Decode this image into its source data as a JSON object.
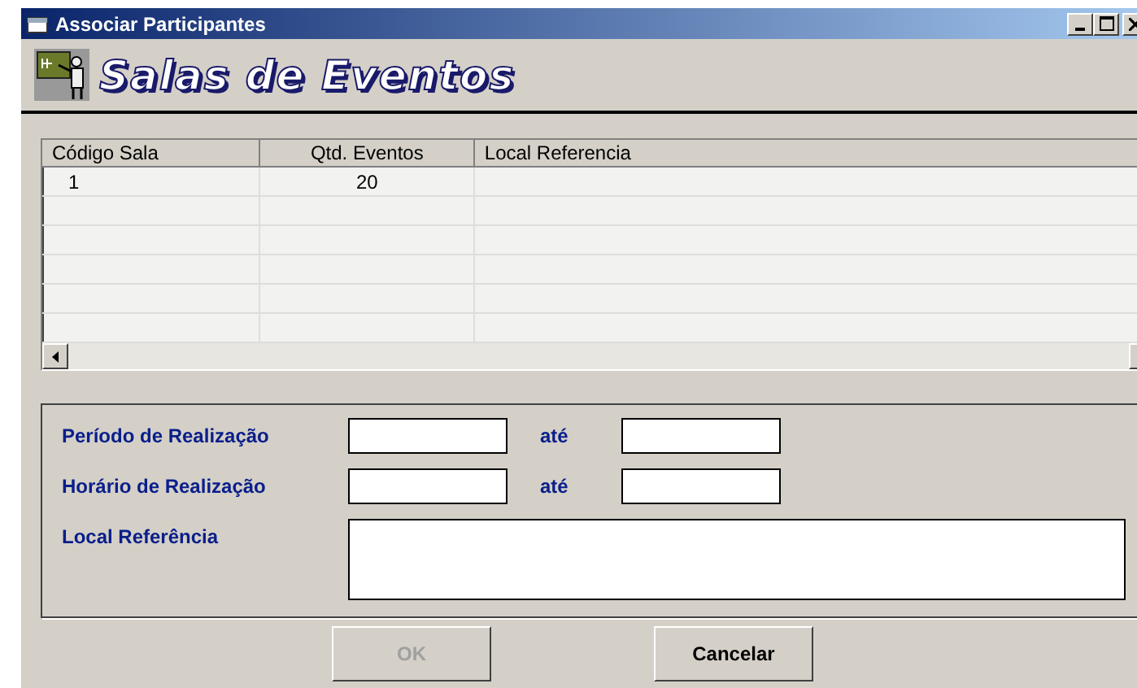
{
  "window": {
    "title": "Associar Participantes"
  },
  "header": {
    "title": "Salas de Eventos"
  },
  "table": {
    "columns": [
      {
        "label": "Código Sala"
      },
      {
        "label": "Qtd. Eventos"
      },
      {
        "label": "Local Referencia"
      }
    ],
    "rows": [
      [
        "1",
        "20",
        ""
      ]
    ]
  },
  "form": {
    "fields": [
      {
        "label": "Período de Realização",
        "kind": "range",
        "between": "até"
      },
      {
        "label": "Horário de Realização",
        "kind": "range",
        "between": "até"
      },
      {
        "label": "Local Referência",
        "kind": "memo"
      }
    ]
  },
  "buttons": [
    {
      "label": "OK",
      "disabled": true
    },
    {
      "label": "Cancelar",
      "disabled": false
    }
  ]
}
